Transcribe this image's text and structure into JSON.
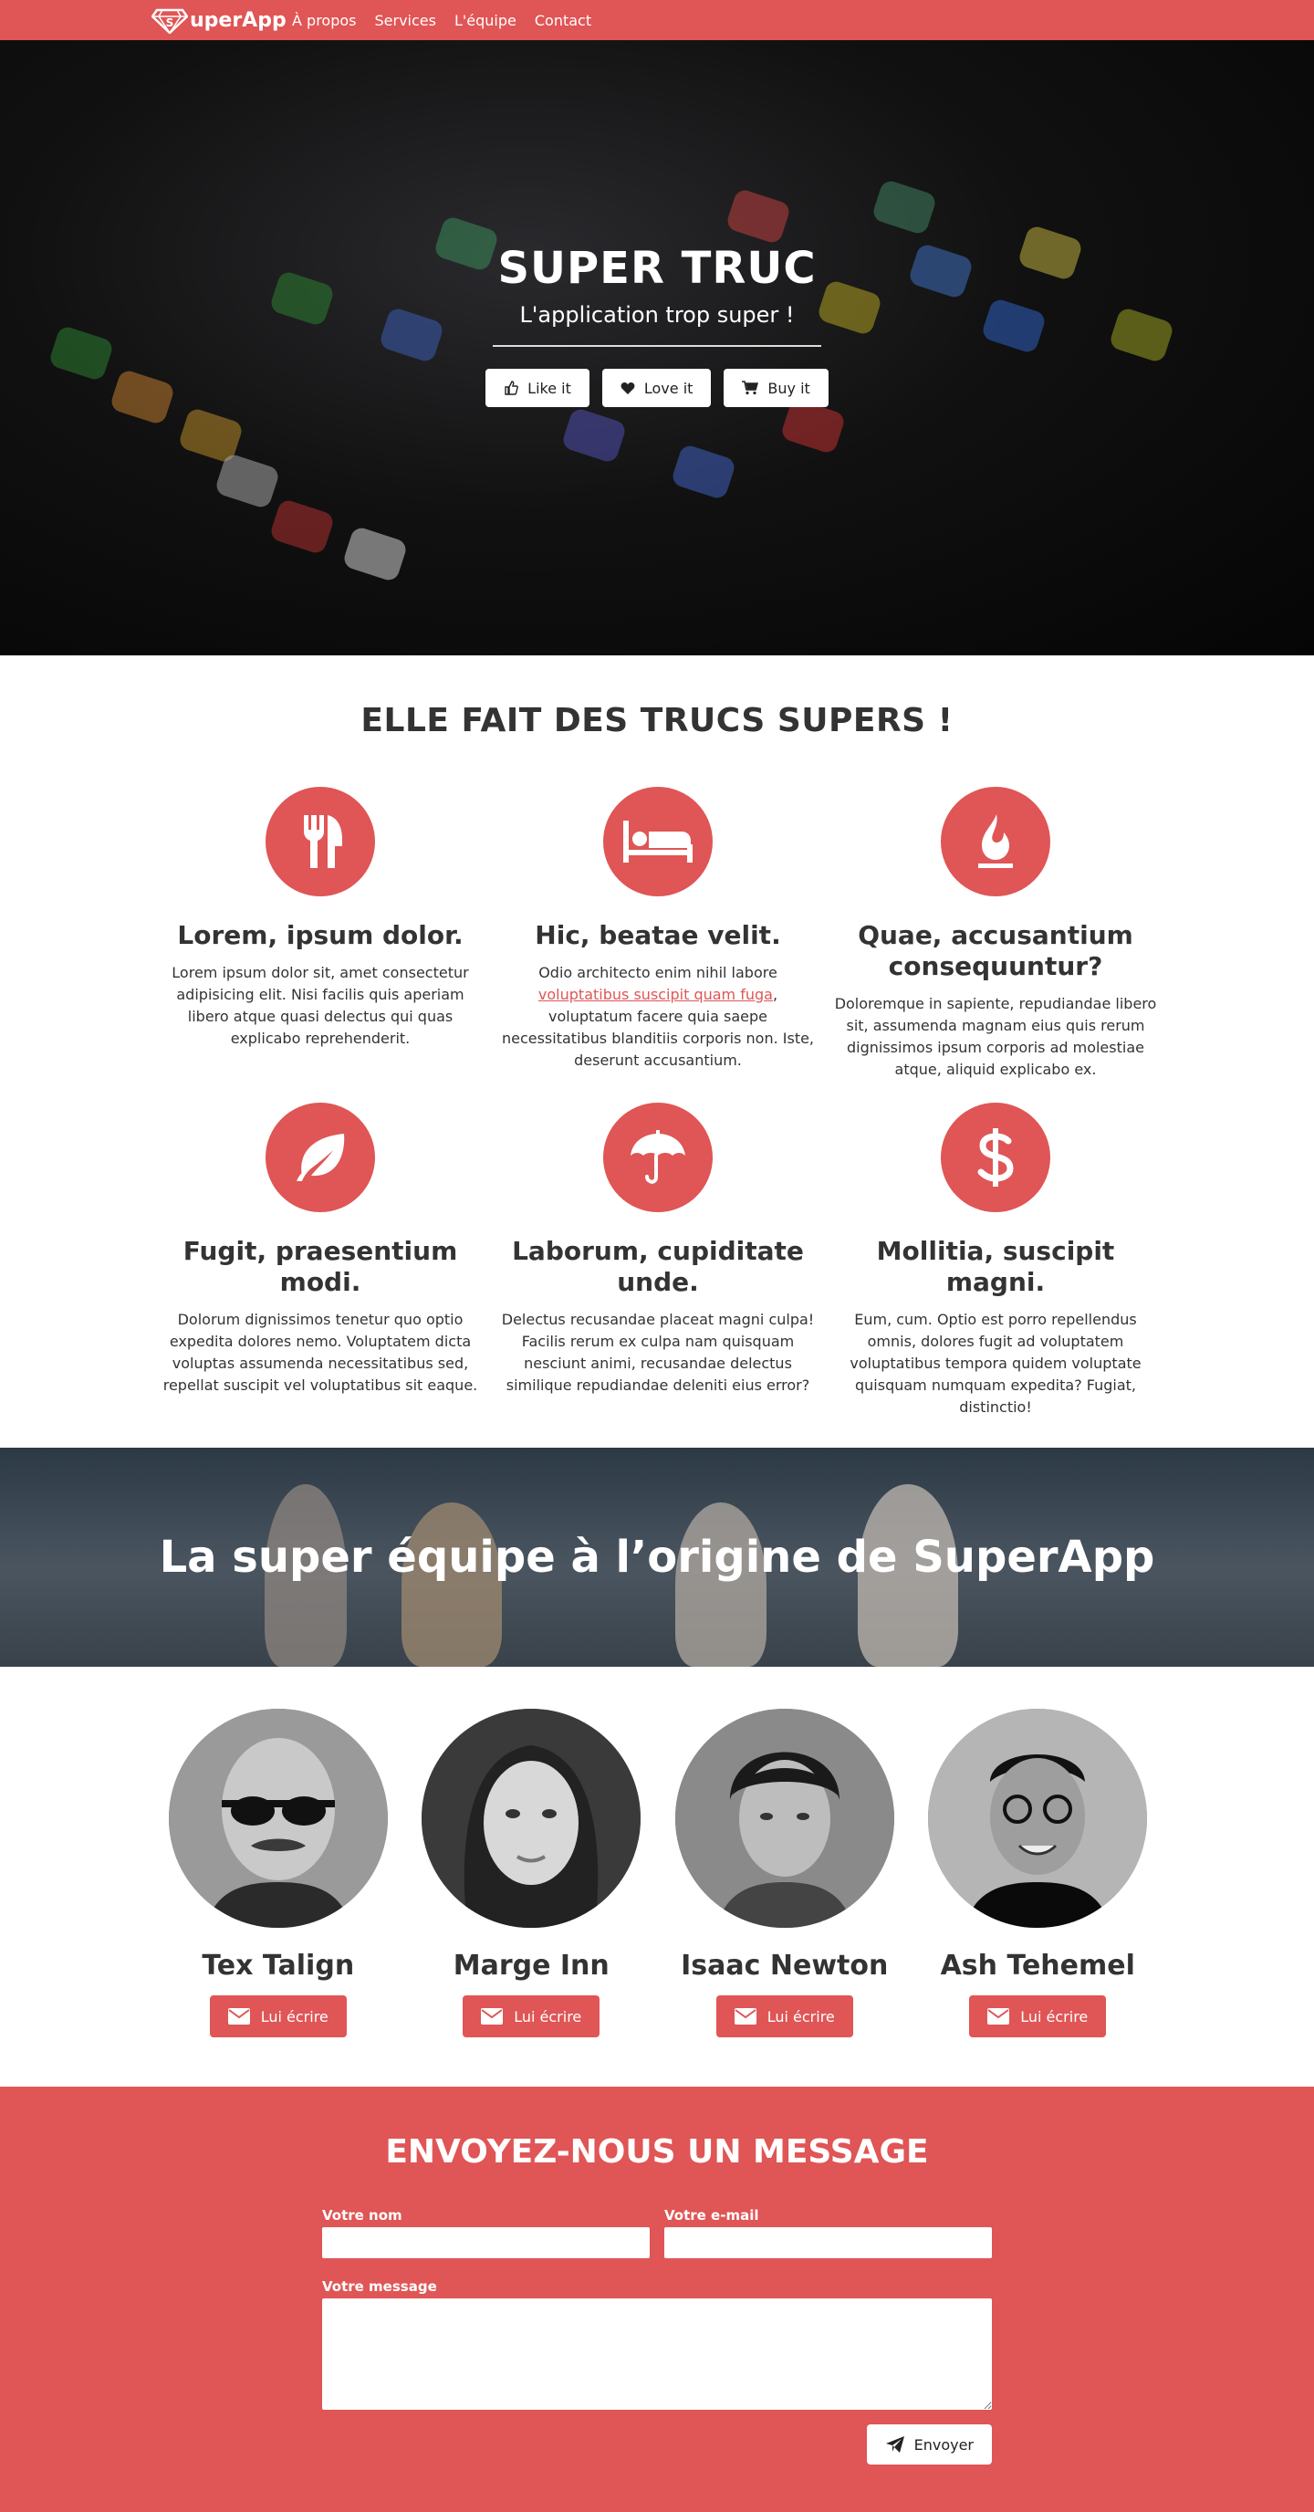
{
  "nav": {
    "brand": "uperApp",
    "items": [
      {
        "label": "À propos"
      },
      {
        "label": "Services"
      },
      {
        "label": "L'équipe"
      },
      {
        "label": "Contact"
      }
    ]
  },
  "hero": {
    "title": "SUPER TRUC",
    "subtitle": "L'application trop super !",
    "buttons": [
      {
        "label": "Like it",
        "icon": "thumbs-up-icon"
      },
      {
        "label": "Love it",
        "icon": "heart-icon"
      },
      {
        "label": "Buy it",
        "icon": "shopping-cart-icon"
      }
    ]
  },
  "features": {
    "heading": "ELLE FAIT DES TRUCS SUPERS !",
    "items": [
      {
        "icon": "cutlery-icon",
        "title": "Lorem, ipsum dolor.",
        "text": "Lorem ipsum dolor sit, amet consectetur adipisicing elit. Nisi facilis quis aperiam libero atque quasi delectus qui quas explicabo reprehenderit."
      },
      {
        "icon": "bed-icon",
        "title": "Hic, beatae velit.",
        "text_before": "Odio architecto enim nihil labore ",
        "link": "voluptatibus suscipit quam fuga",
        "text_after": ", voluptatum facere quia saepe necessitatibus blanditiis corporis non. Iste, deserunt accusantium."
      },
      {
        "icon": "fire-icon",
        "title": "Quae, accusantium consequuntur?",
        "text": "Doloremque in sapiente, repudiandae libero sit, assumenda magnam eius quis rerum dignissimos ipsum corporis ad molestiae atque, aliquid explicabo ex."
      },
      {
        "icon": "leaf-icon",
        "title": "Fugit, praesentium modi.",
        "text": "Dolorum dignissimos tenetur quo optio expedita dolores nemo. Voluptatem dicta voluptas assumenda necessitatibus sed, repellat suscipit vel voluptatibus sit eaque."
      },
      {
        "icon": "umbrella-icon",
        "title": "Laborum, cupiditate unde.",
        "text": "Delectus recusandae placeat magni culpa! Facilis rerum ex culpa nam quisquam nesciunt animi, recusandae delectus similique repudiandae deleniti eius error?"
      },
      {
        "icon": "dollar-icon",
        "title": "Mollitia, suscipit magni.",
        "text": "Eum, cum. Optio est porro repellendus omnis, dolores fugit ad voluptatem voluptatibus tempora quidem voluptate quisquam numquam expedita? Fugiat, distinctio!"
      }
    ]
  },
  "team": {
    "heading": "La super équipe à l’origine de SuperApp",
    "button_label": "Lui écrire",
    "members": [
      {
        "name": "Tex Talign"
      },
      {
        "name": "Marge Inn"
      },
      {
        "name": "Isaac Newton"
      },
      {
        "name": "Ash Tehemel"
      }
    ]
  },
  "contact": {
    "heading": "ENVOYEZ-NOUS UN MESSAGE",
    "name_label": "Votre nom",
    "name_value": "",
    "email_label": "Votre e-mail",
    "email_value": "",
    "message_label": "Votre message",
    "message_value": "",
    "send_label": "Envoyer"
  },
  "colors": {
    "accent": "#e05555",
    "text": "#333333",
    "white": "#ffffff"
  }
}
